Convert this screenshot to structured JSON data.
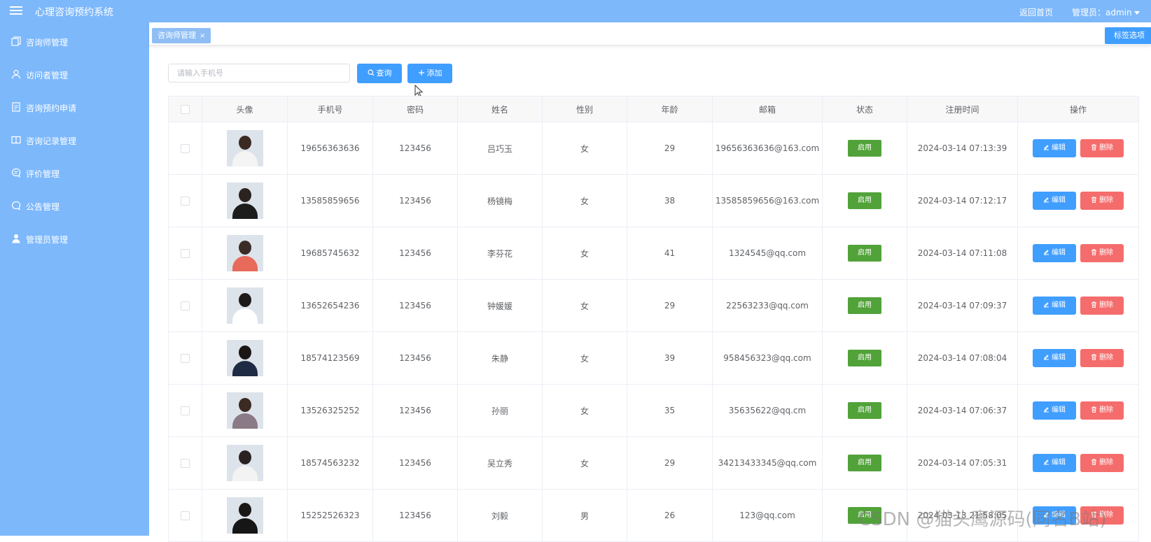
{
  "app": {
    "title": "心理咨询预约系统",
    "home_link": "返回首页",
    "admin_label": "管理员：admin"
  },
  "sidebar": {
    "items": [
      {
        "label": "咨询师管理",
        "icon": "copy-icon"
      },
      {
        "label": "访问者管理",
        "icon": "user-icon"
      },
      {
        "label": "咨询预约申请",
        "icon": "document-icon"
      },
      {
        "label": "咨询记录管理",
        "icon": "book-icon"
      },
      {
        "label": "评价管理",
        "icon": "chat-lines-icon"
      },
      {
        "label": "公告管理",
        "icon": "chat-bubble-icon"
      },
      {
        "label": "管理员管理",
        "icon": "person-solid-icon"
      }
    ]
  },
  "tabs": {
    "active": "咨询师管理",
    "close_glyph": "×",
    "options_label": "标签选项"
  },
  "toolbar": {
    "search_placeholder": "请输入手机号",
    "query_label": "查询",
    "add_label": "添加"
  },
  "table": {
    "headers": [
      "头像",
      "手机号",
      "密码",
      "姓名",
      "性别",
      "年龄",
      "邮箱",
      "状态",
      "注册时间",
      "操作"
    ],
    "edit_label": "编辑",
    "delete_label": "删除",
    "rows": [
      {
        "phone": "19656363636",
        "password": "123456",
        "name": "吕巧玉",
        "gender": "女",
        "age": "29",
        "email": "19656363636@163.com",
        "status": "启用",
        "registered": "2024-03-14 07:13:39"
      },
      {
        "phone": "13585859656",
        "password": "123456",
        "name": "杨镜梅",
        "gender": "女",
        "age": "38",
        "email": "13585859656@163.com",
        "status": "启用",
        "registered": "2024-03-14 07:12:17"
      },
      {
        "phone": "19685745632",
        "password": "123456",
        "name": "李芬花",
        "gender": "女",
        "age": "41",
        "email": "1324545@qq.com",
        "status": "启用",
        "registered": "2024-03-14 07:11:08"
      },
      {
        "phone": "13652654236",
        "password": "123456",
        "name": "钟媛媛",
        "gender": "女",
        "age": "29",
        "email": "22563233@qq.com",
        "status": "启用",
        "registered": "2024-03-14 07:09:37"
      },
      {
        "phone": "18574123569",
        "password": "123456",
        "name": "朱静",
        "gender": "女",
        "age": "39",
        "email": "958456323@qq.com",
        "status": "启用",
        "registered": "2024-03-14 07:08:04"
      },
      {
        "phone": "13526325252",
        "password": "123456",
        "name": "孙丽",
        "gender": "女",
        "age": "35",
        "email": "35635622@qq.cm",
        "status": "启用",
        "registered": "2024-03-14 07:06:37"
      },
      {
        "phone": "18574563232",
        "password": "123456",
        "name": "吴立秀",
        "gender": "女",
        "age": "29",
        "email": "34213433345@qq.com",
        "status": "启用",
        "registered": "2024-03-14 07:05:31"
      },
      {
        "phone": "15252526323",
        "password": "123456",
        "name": "刘毅",
        "gender": "男",
        "age": "26",
        "email": "123@qq.com",
        "status": "启用",
        "registered": "2024-03-13 21:58:05"
      }
    ]
  },
  "watermark": "CSDN @猫头鹰源码(同名B站)",
  "colors": {
    "sidebar": "#7db8fb",
    "primary": "#409eff",
    "danger": "#f56c6c",
    "success": "#52a23a"
  }
}
